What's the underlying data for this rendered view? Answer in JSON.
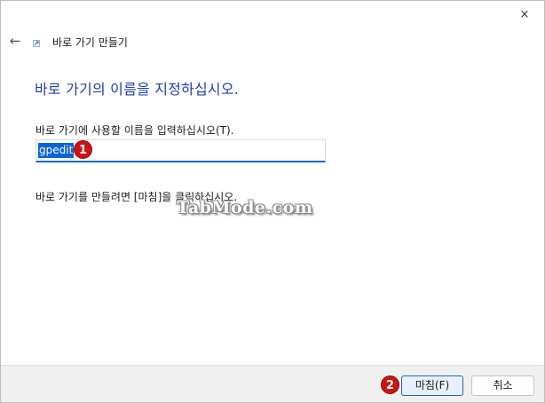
{
  "window": {
    "close_icon": "×",
    "back_icon": "←"
  },
  "wizard": {
    "title": "바로 가기 만들기",
    "heading": "바로 가기의 이름을 지정하십시오.",
    "input_label": "바로 가기에 사용할 이름을 입력하십시오(T).",
    "input_value": "gpedit",
    "finish_hint": "바로 가기를 만들려면 [마침]을 클릭하십시오."
  },
  "annotations": {
    "badge_1": "1",
    "badge_2": "2"
  },
  "watermark": "TabMode.com",
  "footer": {
    "finish_label": "마침(F)",
    "cancel_label": "취소"
  },
  "colors": {
    "heading": "#1f3fae",
    "accent": "#1f66c1",
    "selection": "#0a64d8",
    "badge": "#cc1414"
  },
  "icons": {
    "close": "close-icon",
    "back": "back-arrow-icon",
    "wizard": "shortcut-wizard-icon"
  }
}
